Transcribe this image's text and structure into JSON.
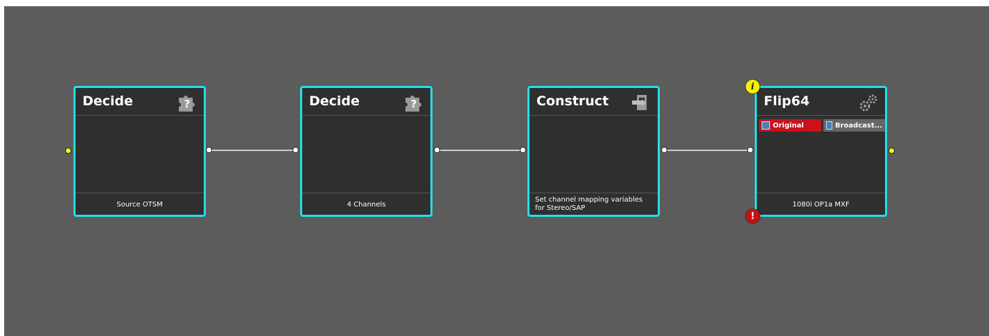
{
  "canvas": {
    "background": "#5c5c5c",
    "node_border": "#21e0e8"
  },
  "nodes": [
    {
      "title": "Decide",
      "icon": "puzzle-question-icon",
      "footer": "Source OTSM"
    },
    {
      "title": "Decide",
      "icon": "puzzle-question-icon",
      "footer": "4 Channels"
    },
    {
      "title": "Construct",
      "icon": "construct-icon",
      "footer": "Set channel mapping variables for Stereo/SAP"
    },
    {
      "title": "Flip64",
      "icon": "gears-icon",
      "footer": "1080i OP1a MXF",
      "tags": [
        {
          "label": "Original",
          "color": "#c8131a"
        },
        {
          "label": "Broadcast...",
          "color": "#666666"
        }
      ],
      "info_badge": "i",
      "error_badge": "!"
    }
  ]
}
